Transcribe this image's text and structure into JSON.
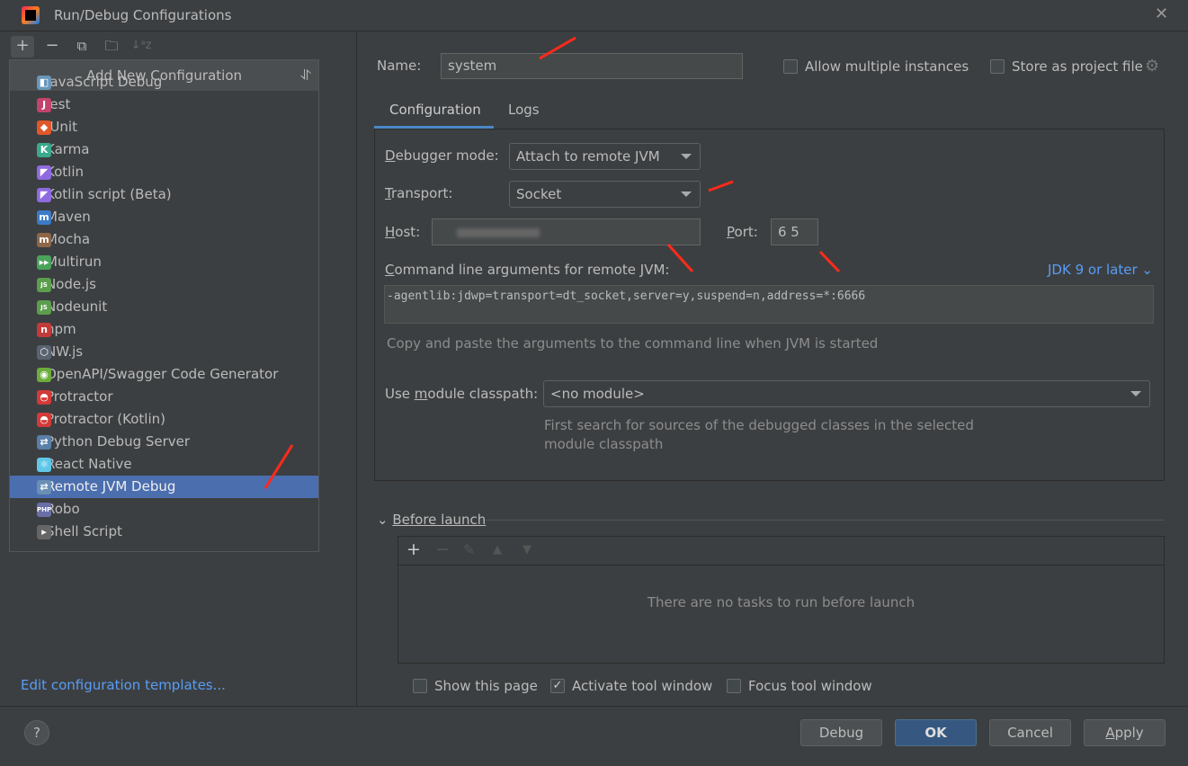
{
  "window": {
    "title": "Run/Debug Configurations"
  },
  "toolbar": {
    "add": "+",
    "remove": "−",
    "sort": "↓ᵃz"
  },
  "popup": {
    "title": "Add New Configuration",
    "selected": "Remote JVM Debug",
    "items": [
      {
        "label": "JavaScript Debug",
        "icon": "javascript-debug-icon",
        "color": "#6897bb",
        "glyph": "◧"
      },
      {
        "label": "Jest",
        "icon": "jest-icon",
        "color": "#c2436b",
        "glyph": "J"
      },
      {
        "label": "JUnit",
        "icon": "junit-icon",
        "color": "#e0582a",
        "glyph": "◆"
      },
      {
        "label": "Karma",
        "icon": "karma-icon",
        "color": "#3aa98e",
        "glyph": "K"
      },
      {
        "label": "Kotlin",
        "icon": "kotlin-icon",
        "color": "#8f6ae0",
        "glyph": "◤"
      },
      {
        "label": "Kotlin script (Beta)",
        "icon": "kotlin-script-icon",
        "color": "#8f6ae0",
        "glyph": "◤"
      },
      {
        "label": "Maven",
        "icon": "maven-icon",
        "color": "#3c7bc6",
        "glyph": "m"
      },
      {
        "label": "Mocha",
        "icon": "mocha-icon",
        "color": "#8d6748",
        "glyph": "m"
      },
      {
        "label": "Multirun",
        "icon": "multirun-icon",
        "color": "#4aa35a",
        "glyph": "▶▶"
      },
      {
        "label": "Node.js",
        "icon": "nodejs-icon",
        "color": "#5b9e4d",
        "glyph": "JS"
      },
      {
        "label": "Nodeunit",
        "icon": "nodeunit-icon",
        "color": "#5b9e4d",
        "glyph": "JS"
      },
      {
        "label": "npm",
        "icon": "npm-icon",
        "color": "#c33a3a",
        "glyph": "n"
      },
      {
        "label": "NW.js",
        "icon": "nwjs-icon",
        "color": "#5a6470",
        "glyph": "⬡"
      },
      {
        "label": "OpenAPI/Swagger Code Generator",
        "icon": "openapi-icon",
        "color": "#6cad3c",
        "glyph": "◉"
      },
      {
        "label": "Protractor",
        "icon": "protractor-icon",
        "color": "#d33a3a",
        "glyph": "◓"
      },
      {
        "label": "Protractor (Kotlin)",
        "icon": "protractor-kotlin-icon",
        "color": "#d33a3a",
        "glyph": "◓"
      },
      {
        "label": "Python Debug Server",
        "icon": "python-debug-icon",
        "color": "#5a7fa8",
        "glyph": "⇄"
      },
      {
        "label": "React Native",
        "icon": "react-native-icon",
        "color": "#5fc7e8",
        "glyph": "⚛"
      },
      {
        "label": "Remote JVM Debug",
        "icon": "remote-jvm-debug-icon",
        "color": "#6a8fb5",
        "glyph": "⇄"
      },
      {
        "label": "Robo",
        "icon": "robo-icon",
        "color": "#6a6fa8",
        "glyph": "PHP"
      },
      {
        "label": "Shell Script",
        "icon": "shell-script-icon",
        "color": "#666",
        "glyph": "▸"
      }
    ]
  },
  "left": {
    "templates_link": "Edit configuration templates..."
  },
  "form": {
    "name_label": "Name:",
    "name_value": "system",
    "allow_multiple": "Allow multiple instances",
    "allow_multiple_checked": false,
    "store_project": "Store as project file",
    "store_project_checked": false,
    "tabs": [
      "Configuration",
      "Logs"
    ],
    "active_tab": "Configuration",
    "debugger_mode_label": "Debugger mode:",
    "debugger_mode": "Attach to remote JVM",
    "transport_label": "Transport:",
    "transport": "Socket",
    "host_label": "Host:",
    "host_value": "",
    "port_label": "Port:",
    "port_value": "6  5",
    "cmd_label": "Command line arguments for remote JVM:",
    "jdk": "JDK 9 or later",
    "cmd_value": "-agentlib:jdwp=transport=dt_socket,server=y,suspend=n,address=*:6666",
    "cmd_hint": "Copy and paste the arguments to the command line when JVM is started",
    "module_label": "Use module classpath:",
    "module_value": "<no module>",
    "module_hint_1": "First search for sources of the debugged classes in the selected",
    "module_hint_2": "module classpath"
  },
  "before_launch": {
    "title": "Before launch",
    "empty": "There are no tasks to run before launch",
    "show_page": "Show this page",
    "show_page_checked": false,
    "activate": "Activate tool window",
    "activate_checked": true,
    "focus": "Focus tool window",
    "focus_checked": false
  },
  "buttons": {
    "help": "?",
    "debug": "Debug",
    "ok": "OK",
    "cancel": "Cancel",
    "apply": "Apply"
  },
  "colors": {
    "accent": "#4b6eaf",
    "link": "#589df6",
    "annotation": "#ff2a1a"
  }
}
